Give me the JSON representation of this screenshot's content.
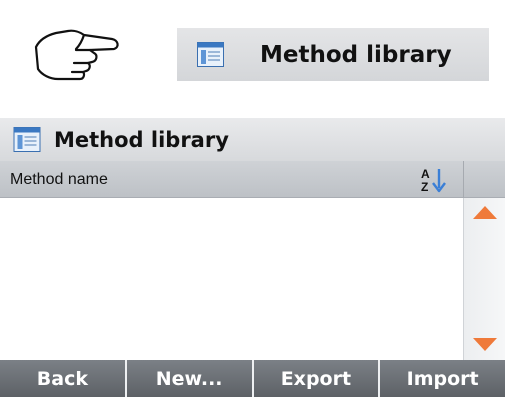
{
  "instruction": {
    "hand_icon": "pointing-hand-icon",
    "reference_button": {
      "icon": "method-library-icon",
      "label": "Method library"
    }
  },
  "dialog": {
    "title_icon": "method-library-icon",
    "title": "Method library",
    "column_header": {
      "label": "Method name",
      "sort_icon": "sort-az-icon"
    },
    "list_items": [],
    "scrollbar": {
      "up_icon": "scroll-up-icon",
      "down_icon": "scroll-down-icon"
    },
    "buttons": {
      "back": "Back",
      "new": "New...",
      "export": "Export",
      "import": "Import"
    }
  },
  "colors": {
    "accent_orange": "#ef7a3a",
    "sort_blue": "#3b7fd6",
    "button_bar": "#62666b"
  }
}
